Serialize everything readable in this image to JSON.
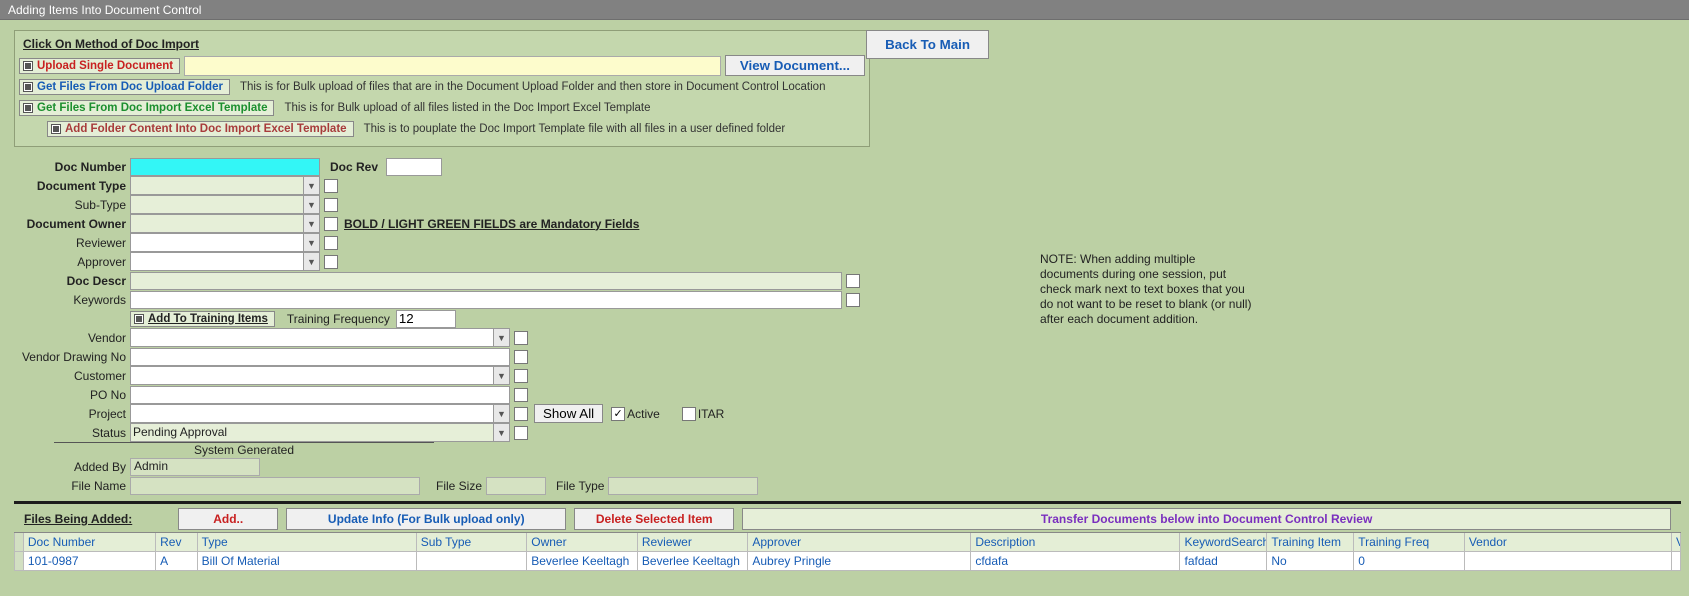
{
  "window": {
    "title": "Adding Items Into Document Control"
  },
  "backButton": "Back To Main",
  "panel": {
    "title": "Click On Method of Doc Import",
    "methods": {
      "upload": "Upload Single Document",
      "getFolder": "Get Files From Doc Upload Folder",
      "getFolderDesc": "This is for Bulk upload of files that are in the Document Upload Folder and then store in Document Control Location",
      "getExcel": "Get Files From Doc Import Excel Template",
      "getExcelDesc": "This is for Bulk upload of all files listed in the Doc Import Excel Template",
      "addFolder": "Add Folder Content Into Doc Import Excel Template",
      "addFolderDesc": "This is to pouplate the Doc Import Template file with all files in a user defined folder"
    },
    "viewDoc": "View Document...",
    "filePath": ""
  },
  "form": {
    "docNumberLabel": "Doc Number",
    "docNumber": "",
    "docRevLabel": "Doc Rev",
    "docRev": "",
    "docTypeLabel": "Document Type",
    "docType": "",
    "subTypeLabel": "Sub-Type",
    "subType": "",
    "docOwnerLabel": "Document Owner",
    "docOwner": "",
    "reviewerLabel": "Reviewer",
    "reviewer": "",
    "approverLabel": "Approver",
    "approver": "",
    "docDescrLabel": "Doc Descr",
    "docDescr": "",
    "keywordsLabel": "Keywords",
    "keywords": "",
    "trainingBtn": "Add To Training Items",
    "trainingFreqLabel": "Training Frequency",
    "trainingFreq": "12",
    "vendorLabel": "Vendor",
    "vendor": "",
    "vendorDwgLabel": "Vendor Drawing No",
    "vendorDwg": "",
    "customerLabel": "Customer",
    "customer": "",
    "poNoLabel": "PO No",
    "poNo": "",
    "projectLabel": "Project",
    "project": "",
    "statusLabel": "Status",
    "status": "Pending Approval",
    "mandatoryNote": "BOLD / LIGHT GREEN FIELDS are Mandatory Fields",
    "showAll": "Show All",
    "activeLabel": "Active",
    "itarLabel": "ITAR",
    "sysGen": "System Generated",
    "addedByLabel": "Added By",
    "addedBy": "Admin",
    "fileNameLabel": "File Name",
    "fileName": "",
    "fileSizeLabel": "File Size",
    "fileSize": "",
    "fileTypeLabel": "File Type",
    "fileType": ""
  },
  "note": "NOTE: When adding multiple documents during one session, put check mark next to text boxes that you do not want to be reset to blank (or null)  after each document addition.",
  "filesBeing": {
    "title": "Files Being Added:",
    "addBtn": "Add..",
    "updateBtn": "Update Info (For Bulk upload only)",
    "deleteBtn": "Delete Selected Item",
    "transferBtn": "Transfer Documents below into Document Control Review"
  },
  "grid": {
    "headers": [
      "Doc Number",
      "Rev",
      "Type",
      "Sub Type",
      "Owner",
      "Reviewer",
      "Approver",
      "Description",
      "KeywordSearch",
      "Training Item",
      "Training Freq",
      "Vendor",
      "Vendor Dwg No"
    ],
    "rows": [
      [
        "101-0987",
        "A",
        "Bill Of Material",
        "",
        "Beverlee Keeltagh",
        "Beverlee Keeltagh",
        "Aubrey Pringle",
        "cfdafa",
        "fafdad",
        "No",
        "0",
        "",
        ""
      ]
    ]
  }
}
